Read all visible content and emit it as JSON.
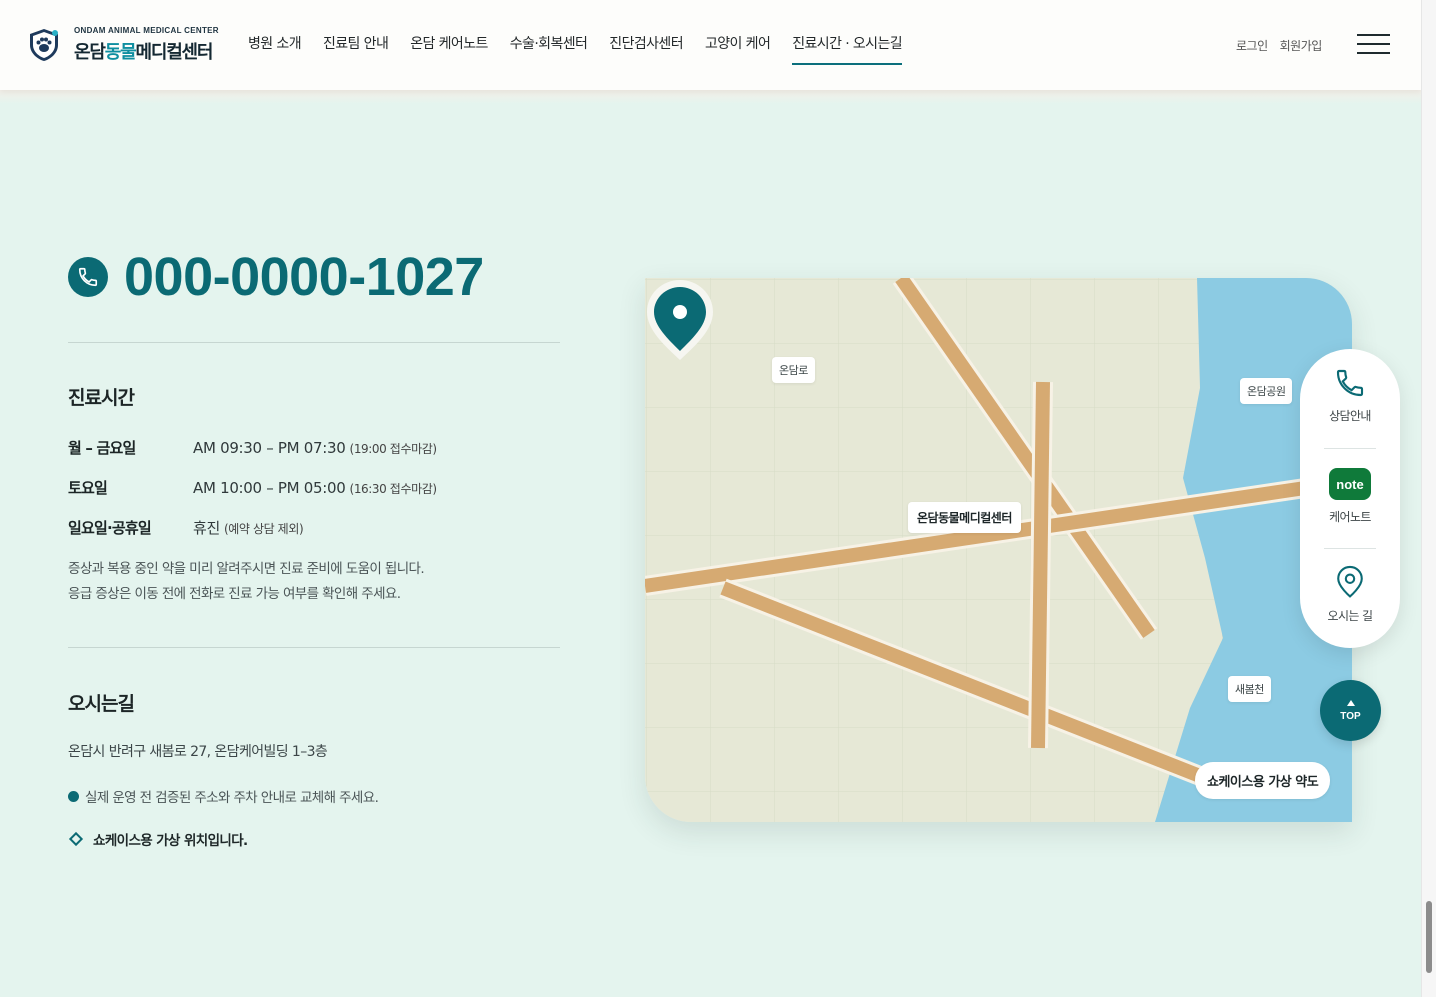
{
  "header": {
    "logo_sub": "ONDAM ANIMAL MEDICAL CENTER",
    "logo_name_1": "온담",
    "logo_name_2": "동물",
    "logo_name_3": "메디컬센터",
    "nav": [
      "병원 소개",
      "진료팀 안내",
      "온담 케어노트",
      "수술·회복센터",
      "진단검사센터",
      "고양이 케어",
      "진료시간 · 오시는길"
    ],
    "active_nav": "진료시간 · 오시는길",
    "login": "로그인",
    "signup": "회원가입"
  },
  "contact": {
    "phone": "000-0000-1027"
  },
  "hours": {
    "title": "진료시간",
    "rows": [
      {
        "day": "월 – 금요일",
        "time": "AM 09:30 – PM 07:30",
        "note": "(19:00 접수마감)"
      },
      {
        "day": "토요일",
        "time": "AM 10:00 – PM 05:00",
        "note": "(16:30 접수마감)"
      },
      {
        "day": "일요일·공휴일",
        "time": "휴진",
        "note": "(예약 상담 제외)"
      }
    ],
    "notice_1": "증상과 복용 중인 약을 미리 알려주시면 진료 준비에 도움이 됩니다.",
    "notice_2": "응급 증상은 이동 전에 전화로 진료 가능 여부를 확인해 주세요."
  },
  "directions": {
    "title": "오시는길",
    "address": "온담시 반려구 새봄로 27, 온담케어빌딩 1–3층",
    "bullet_1": "실제 운영 전 검증된 주소와 주차 안내로 교체해 주세요.",
    "bullet_2": "쇼케이스용 가상 위치입니다."
  },
  "map": {
    "label_road": "온담로",
    "label_park": "온담공원",
    "label_center": "온담동물메디컬센터",
    "label_stream": "새봄천",
    "label_bottom": "쇼케이스용 가상 약도",
    "colors": {
      "land": "#e6e8d6",
      "water": "#8ccbe3",
      "road": "#d6aa72",
      "pin": "#0b6a74"
    }
  },
  "quick_menu": {
    "consult": "상담안내",
    "note_badge": "note",
    "carenote": "케어노트",
    "directions": "오시는 길",
    "top": "TOP"
  }
}
